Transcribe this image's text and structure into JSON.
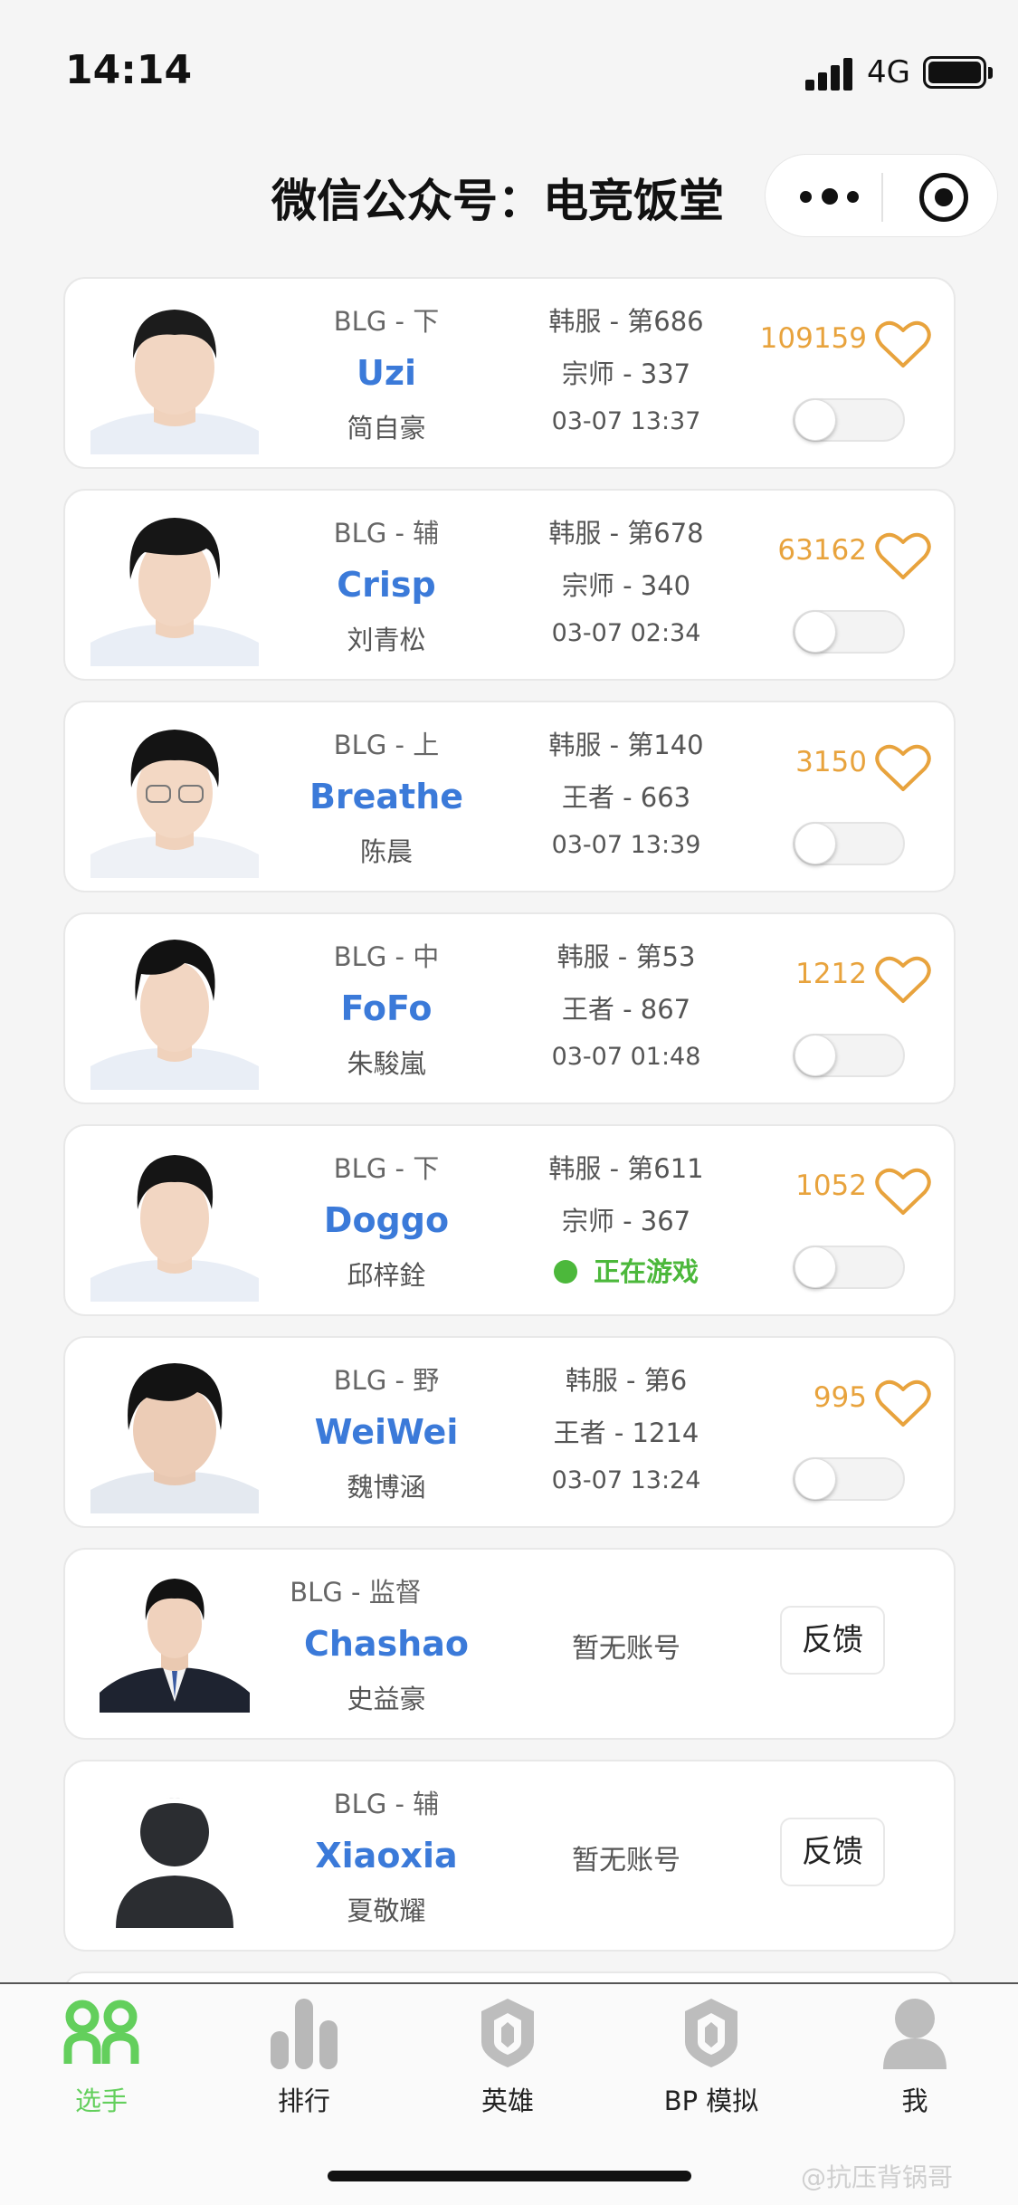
{
  "status": {
    "time": "14:14",
    "network": "4G"
  },
  "header": {
    "title": "微信公众号：电竞饭堂"
  },
  "players": [
    {
      "team": "BLG - 下",
      "name": "Uzi",
      "cname": "简自豪",
      "server": "韩服 - 第686",
      "rank": "宗师 - 337",
      "time": "03-07 13:37",
      "likes": "109159",
      "playing": false
    },
    {
      "team": "BLG - 辅",
      "name": "Crisp",
      "cname": "刘青松",
      "server": "韩服 - 第678",
      "rank": "宗师 - 340",
      "time": "03-07 02:34",
      "likes": "63162",
      "playing": false
    },
    {
      "team": "BLG - 上",
      "name": "Breathe",
      "cname": "陈晨",
      "server": "韩服 - 第140",
      "rank": "王者 - 663",
      "time": "03-07 13:39",
      "likes": "3150",
      "playing": false
    },
    {
      "team": "BLG - 中",
      "name": "FoFo",
      "cname": "朱駿嵐",
      "server": "韩服 - 第53",
      "rank": "王者 - 867",
      "time": "03-07 01:48",
      "likes": "1212",
      "playing": false
    },
    {
      "team": "BLG - 下",
      "name": "Doggo",
      "cname": "邱梓銓",
      "server": "韩服 - 第611",
      "rank": "宗师 - 367",
      "status": "正在游戏",
      "likes": "1052",
      "playing": true
    },
    {
      "team": "BLG - 野",
      "name": "WeiWei",
      "cname": "魏博涵",
      "server": "韩服 - 第6",
      "rank": "王者 - 1214",
      "time": "03-07 13:24",
      "likes": "995",
      "playing": false
    }
  ],
  "staff": [
    {
      "team": "BLG - 监督",
      "name": "Chashao",
      "cname": "史益豪",
      "no_account": "暂无账号",
      "feedback": "反馈"
    },
    {
      "team": "BLG - 辅",
      "name": "Xiaoxia",
      "cname": "夏敬耀",
      "no_account": "暂无账号",
      "feedback": "反馈"
    }
  ],
  "tabs": [
    {
      "label": "选手",
      "icon": "players-icon"
    },
    {
      "label": "排行",
      "icon": "ranking-icon"
    },
    {
      "label": "英雄",
      "icon": "hero-icon"
    },
    {
      "label": "BP 模拟",
      "icon": "bp-simulation-icon"
    },
    {
      "label": "我",
      "icon": "profile-icon"
    }
  ],
  "watermark": "@抗压背锅哥",
  "colors": {
    "accent_blue": "#3b7ad9",
    "likes_orange": "#e8a33d",
    "playing_green": "#4cb83b",
    "tab_active": "#63cf5c"
  }
}
